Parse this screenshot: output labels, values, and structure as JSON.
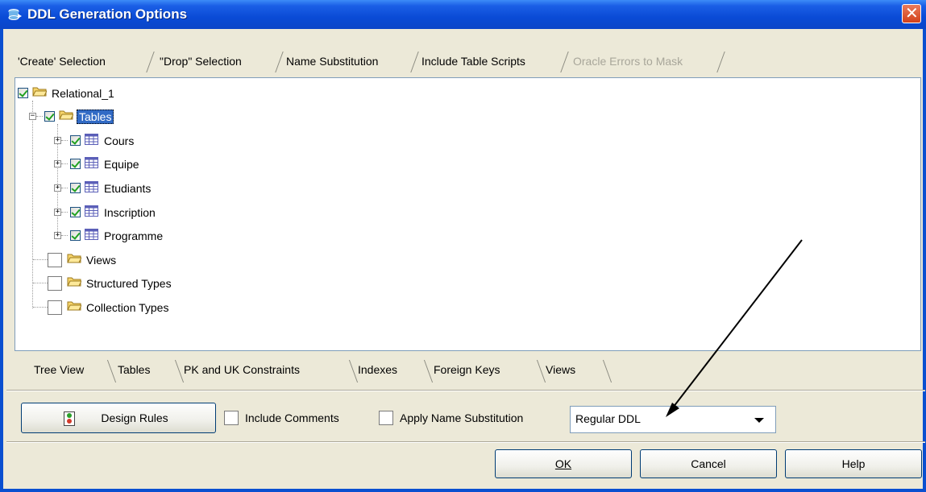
{
  "window": {
    "title": "DDL Generation Options",
    "close_glyph": "✕"
  },
  "top_tabs": [
    {
      "label": "'Create' Selection",
      "enabled": true
    },
    {
      "label": "\"Drop\" Selection",
      "enabled": true
    },
    {
      "label": "Name Substitution",
      "enabled": true
    },
    {
      "label": "Include Table Scripts",
      "enabled": true
    },
    {
      "label": "Oracle Errors to Mask",
      "enabled": false
    }
  ],
  "tree": {
    "root": {
      "label": "Relational_1",
      "checked": true
    },
    "tables": {
      "label": "Tables",
      "checked": true,
      "selected": true
    },
    "table_items": [
      {
        "label": "Cours",
        "checked": true
      },
      {
        "label": "Equipe",
        "checked": true
      },
      {
        "label": "Etudiants",
        "checked": true
      },
      {
        "label": "Inscription",
        "checked": true
      },
      {
        "label": "Programme",
        "checked": true
      }
    ],
    "other_folders": [
      {
        "label": "Views",
        "checked": false
      },
      {
        "label": "Structured Types",
        "checked": false
      },
      {
        "label": "Collection Types",
        "checked": false
      }
    ]
  },
  "bottom_tabs": [
    "Tree View",
    "Tables",
    "PK and UK Constraints",
    "Indexes",
    "Foreign Keys",
    "Views"
  ],
  "options": {
    "design_rules_label": "Design Rules",
    "include_comments_label": "Include Comments",
    "include_comments_checked": false,
    "apply_substitution_label": "Apply Name Substitution",
    "apply_substitution_checked": false,
    "ddl_mode": "Regular DDL"
  },
  "buttons": {
    "ok": "OK",
    "cancel": "Cancel",
    "help": "Help"
  },
  "colors": {
    "title_bar": "#0a4bd6",
    "selection": "#316ac5",
    "dialog_bg": "#ece9d8",
    "close": "#d2401a"
  }
}
